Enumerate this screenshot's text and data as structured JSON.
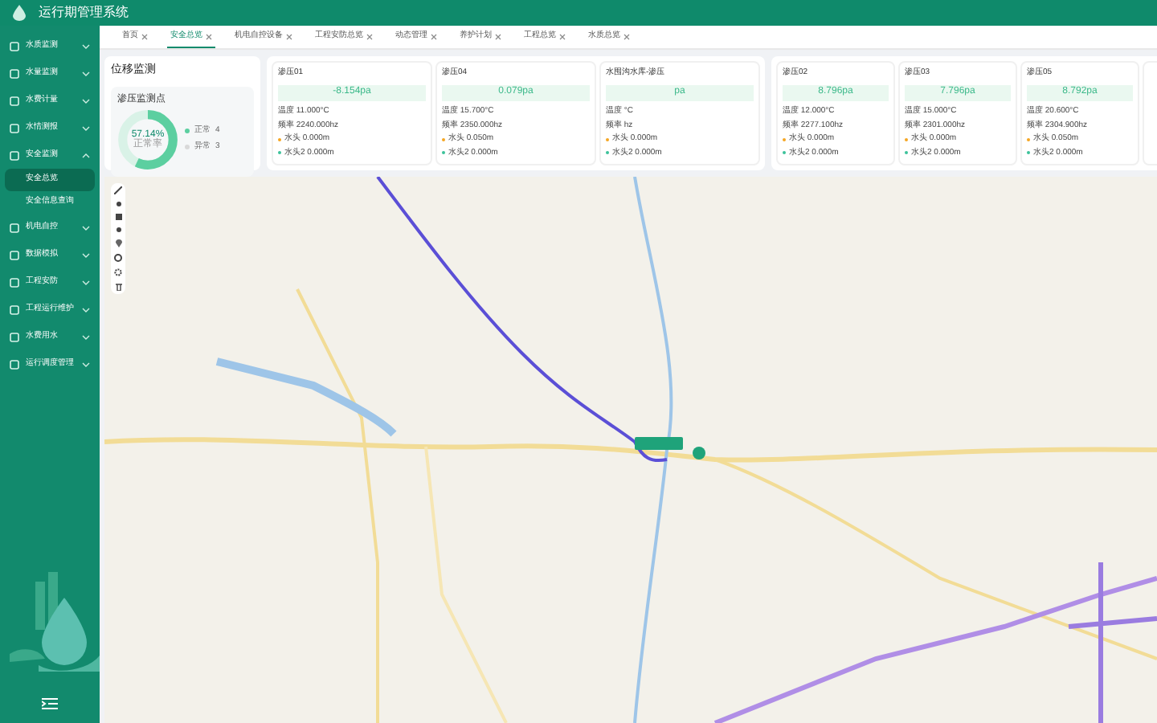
{
  "header": {
    "title": "运行期管理系统"
  },
  "sidebar": {
    "items": [
      {
        "label": "水质监测",
        "expanded": false
      },
      {
        "label": "水量监测",
        "expanded": false
      },
      {
        "label": "水费计量",
        "expanded": false
      },
      {
        "label": "水情测报",
        "expanded": false
      },
      {
        "label": "安全监测",
        "expanded": true,
        "children": [
          {
            "label": "安全总览",
            "selected": true
          },
          {
            "label": "安全信息查询",
            "selected": false
          }
        ]
      },
      {
        "label": "机电自控",
        "expanded": false
      },
      {
        "label": "数据模拟",
        "expanded": false
      },
      {
        "label": "工程安防",
        "expanded": false
      },
      {
        "label": "工程运行维护",
        "expanded": false
      },
      {
        "label": "水费用水",
        "expanded": false
      },
      {
        "label": "运行调度管理",
        "expanded": false
      }
    ]
  },
  "tabs": [
    {
      "label": "首页",
      "selected": false
    },
    {
      "label": "安全总览",
      "selected": true
    },
    {
      "label": "机电自控设备",
      "selected": false
    },
    {
      "label": "工程安防总览",
      "selected": false
    },
    {
      "label": "动态管理",
      "selected": false
    },
    {
      "label": "养护计划",
      "selected": false
    },
    {
      "label": "工程总览",
      "selected": false
    },
    {
      "label": "水质总览",
      "selected": false
    }
  ],
  "overview": {
    "title": "位移监测",
    "subtitle": "渗压监测点",
    "donut": {
      "level": 0.5714,
      "value": "57.14%",
      "caption": "正常率"
    },
    "legend": [
      {
        "label": "正常",
        "count": "4",
        "color": "#5ccfa0"
      },
      {
        "label": "异常",
        "count": "3",
        "color": "#d9d9d9"
      }
    ]
  },
  "sensor_groups": [
    [
      {
        "name": "渗压01",
        "reading": "-8.154pa",
        "temperature": "温度 11.000°C",
        "frequency": "频率 2240.000hz",
        "heads": [
          {
            "text": "水头 0.000m",
            "color": "#f5a623"
          },
          {
            "text": "水头2 0.000m",
            "color": "#3cc29a"
          }
        ]
      },
      {
        "name": "渗压04",
        "reading": "0.079pa",
        "temperature": "温度 15.700°C",
        "frequency": "频率 2350.000hz",
        "heads": [
          {
            "text": "水头 0.050m",
            "color": "#f5a623"
          },
          {
            "text": "水头2 0.000m",
            "color": "#3cc29a"
          }
        ]
      },
      {
        "name": "水囤沟水库-渗压",
        "reading": "pa",
        "temperature": "温度 °C",
        "frequency": "频率 hz",
        "heads": [
          {
            "text": "水头 0.000m",
            "color": "#f5a623"
          },
          {
            "text": "水头2 0.000m",
            "color": "#3cc29a"
          }
        ]
      }
    ],
    [
      {
        "name": "渗压02",
        "reading": "8.796pa",
        "temperature": "温度 12.000°C",
        "frequency": "频率 2277.100hz",
        "heads": [
          {
            "text": "水头 0.000m",
            "color": "#f5a623"
          },
          {
            "text": "水头2 0.000m",
            "color": "#3cc29a"
          }
        ]
      },
      {
        "name": "渗压03",
        "reading": "7.796pa",
        "temperature": "温度 15.000°C",
        "frequency": "频率 2301.000hz",
        "heads": [
          {
            "text": "水头 0.000m",
            "color": "#f5a623"
          },
          {
            "text": "水头2 0.000m",
            "color": "#3cc29a"
          }
        ]
      },
      {
        "name": "渗压05",
        "reading": "8.792pa",
        "temperature": "温度 20.600°C",
        "frequency": "频率 2304.900hz",
        "heads": [
          {
            "text": "水头 0.050m",
            "color": "#f5a623"
          },
          {
            "text": "水头2 0.000m",
            "color": "#3cc29a"
          }
        ]
      }
    ]
  ]
}
